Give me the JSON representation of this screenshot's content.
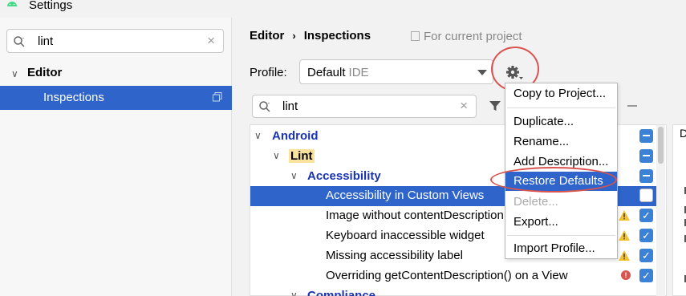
{
  "window": {
    "title": "Settings"
  },
  "left": {
    "search_value": "lint",
    "tree": {
      "editor_label": "Editor",
      "inspections_label": "Inspections"
    }
  },
  "header": {
    "breadcrumb_parent": "Editor",
    "breadcrumb_sep": "›",
    "breadcrumb_current": "Inspections",
    "for_project": "For current project"
  },
  "profile": {
    "label": "Profile:",
    "value": "Default",
    "suffix": "IDE"
  },
  "filter": {
    "search_value": "lint"
  },
  "tree": {
    "rows": [
      {
        "label": "Android"
      },
      {
        "label": "Lint"
      },
      {
        "label": "Accessibility"
      },
      {
        "label": "Accessibility in Custom Views"
      },
      {
        "label": "Image without contentDescription"
      },
      {
        "label": "Keyboard inaccessible widget"
      },
      {
        "label": "Missing accessibility label"
      },
      {
        "label": "Overriding getContentDescription() on a View"
      },
      {
        "label": "Compliance"
      }
    ]
  },
  "desc_panel": {
    "letter": "D"
  },
  "menu": {
    "items": [
      {
        "label": "Copy to Project..."
      },
      {
        "label": "Duplicate..."
      },
      {
        "label": "Rename..."
      },
      {
        "label": "Add Description..."
      },
      {
        "label": "Restore Defaults"
      },
      {
        "label": "Delete..."
      },
      {
        "label": "Export..."
      },
      {
        "label": "Import Profile..."
      }
    ]
  },
  "colors": {
    "accent": "#2f65ca",
    "category": "#1a33b5",
    "highlight": "#fbe29c",
    "annotation": "#d9534f"
  },
  "icons": [
    "android-icon",
    "search-icon",
    "clear-icon",
    "copy-icon",
    "gear-icon",
    "filter-icon",
    "warning-icon",
    "error-icon",
    "chevron-down-icon"
  ]
}
